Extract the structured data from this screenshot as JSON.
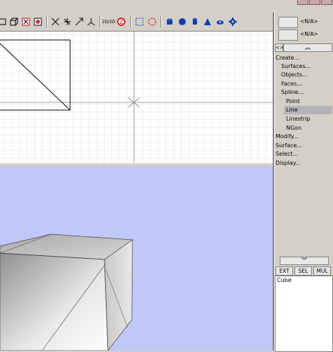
{
  "toolbar": {
    "icons": [
      "window-icon",
      "cube-outline-icon",
      "wireframe-select-icon",
      "texture-icon",
      "move-icon",
      "rotate-icon",
      "scale-icon",
      "axis-icon",
      "view-2d-3d-icon",
      "zoom-icon",
      "grid-select-icon",
      "snap-icon",
      "cylinder-icon",
      "sphere-icon",
      "cylinder-icon-2",
      "cone-icon",
      "torus-icon",
      "gear-icon"
    ],
    "view_toggle_label": "2D/3D"
  },
  "panel": {
    "combo1_label": "<N/A>",
    "combo2_label": "<N/A>",
    "collapse_label": "<>",
    "scroll_up_label": "︽",
    "scroll_down_label": "︾",
    "menu": [
      {
        "label": "Create...",
        "level": 0,
        "selected": false
      },
      {
        "label": "Surfaces...",
        "level": 1,
        "selected": false
      },
      {
        "label": "Objects...",
        "level": 1,
        "selected": false
      },
      {
        "label": "Faces...",
        "level": 1,
        "selected": false
      },
      {
        "label": "Spline...",
        "level": 1,
        "selected": false
      },
      {
        "label": "Point",
        "level": 2,
        "selected": false
      },
      {
        "label": "Line",
        "level": 2,
        "selected": true
      },
      {
        "label": "Linestrip",
        "level": 2,
        "selected": false
      },
      {
        "label": "NGon",
        "level": 2,
        "selected": false
      },
      {
        "label": "Modify...",
        "level": 0,
        "selected": false
      },
      {
        "label": "Surface...",
        "level": 0,
        "selected": false
      },
      {
        "label": "Select...",
        "level": 0,
        "selected": false
      },
      {
        "label": "Display...",
        "level": 0,
        "selected": false
      }
    ],
    "mode_buttons": [
      "EXT",
      "SEL",
      "MUL"
    ],
    "objects": [
      "Cube"
    ]
  },
  "colors": {
    "background": "#d4d0c8",
    "viewport_3d": "#c0c8f8",
    "grid": "#e0e0e0",
    "selection": "#b4b4b8"
  }
}
